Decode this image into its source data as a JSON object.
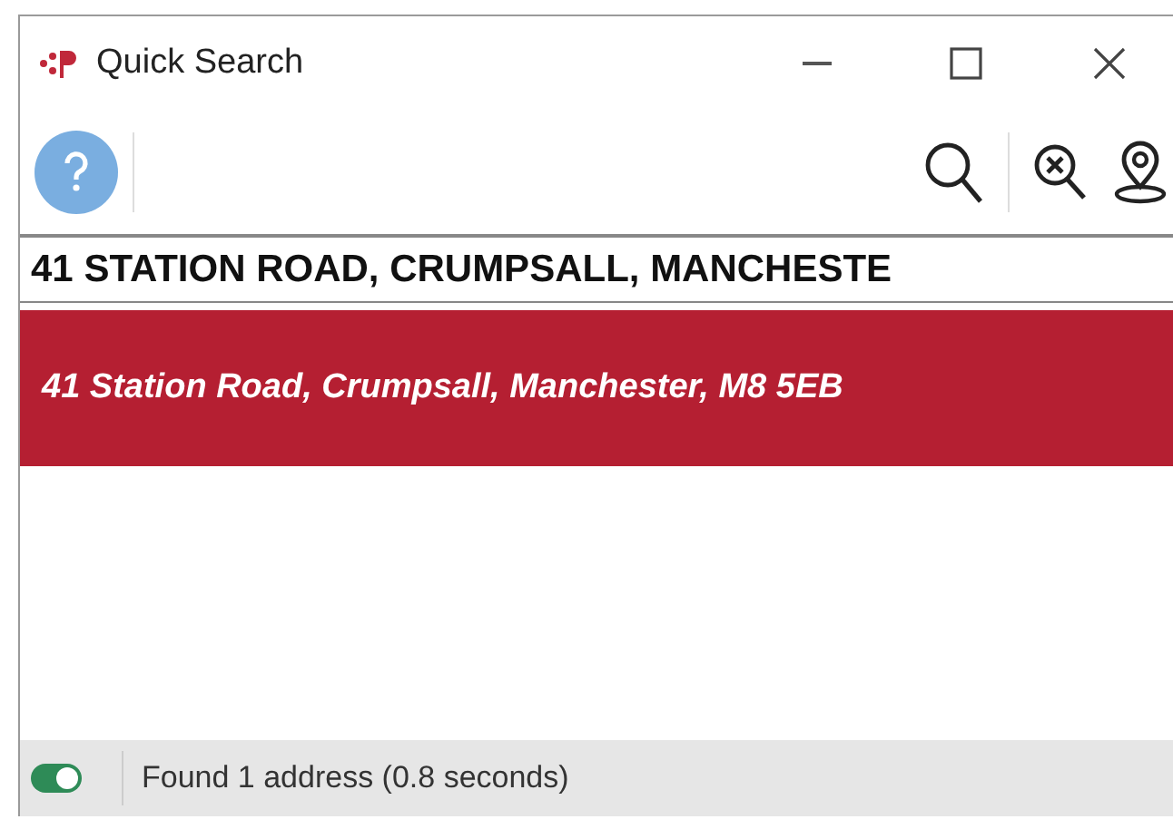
{
  "window": {
    "title": "Quick Search"
  },
  "search": {
    "value": "41 STATION ROAD, CRUMPSALL, MANCHESTE"
  },
  "results": [
    {
      "text": "41 Station Road, Crumpsall, Manchester, M8 5EB",
      "selected": true
    }
  ],
  "status_bar": {
    "toggle_on": true,
    "text": "Found 1 address (0.8 seconds)"
  }
}
